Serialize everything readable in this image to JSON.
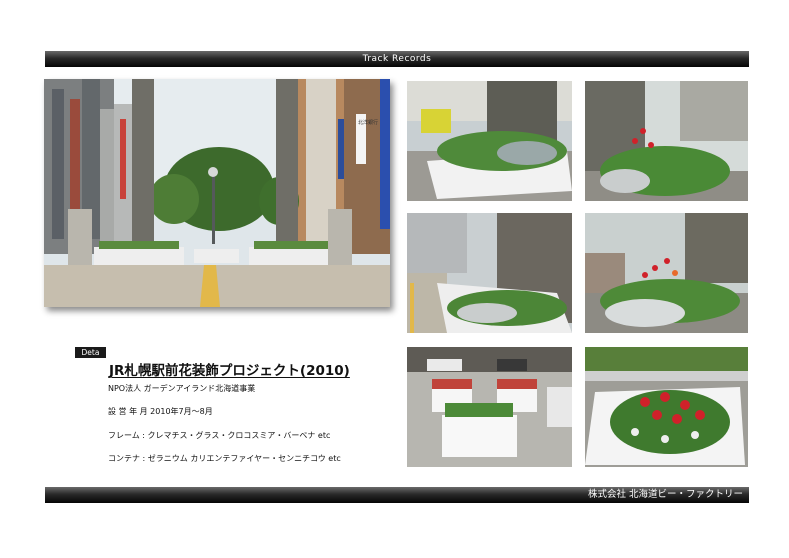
{
  "header": {
    "title": "Track  Records"
  },
  "footer": {
    "company": "株式会社  北海道ビー・ファクトリー"
  },
  "detail": {
    "badge": "Deta",
    "title": "JR札幌駅前花装飾プロジェクト(2010)",
    "organizer": "NPO法人  ガーデンアイランド北海道事業",
    "period": "設 営 年 月  2010年7月～8月",
    "frame": "フレーム : クレマチス・グラス・クロコスミア・バーベナ  etc",
    "container": "コンテナ : ゼラニウム  カリエンテファイヤー・センニチコウ etc"
  },
  "photo_signs": {
    "bank_sign": "北洋銀行"
  },
  "colors": {
    "bar": "#1a1a1a",
    "foliage": "#4f8a3a",
    "flower_red": "#d0212a",
    "planter": "#f4f4f4"
  }
}
